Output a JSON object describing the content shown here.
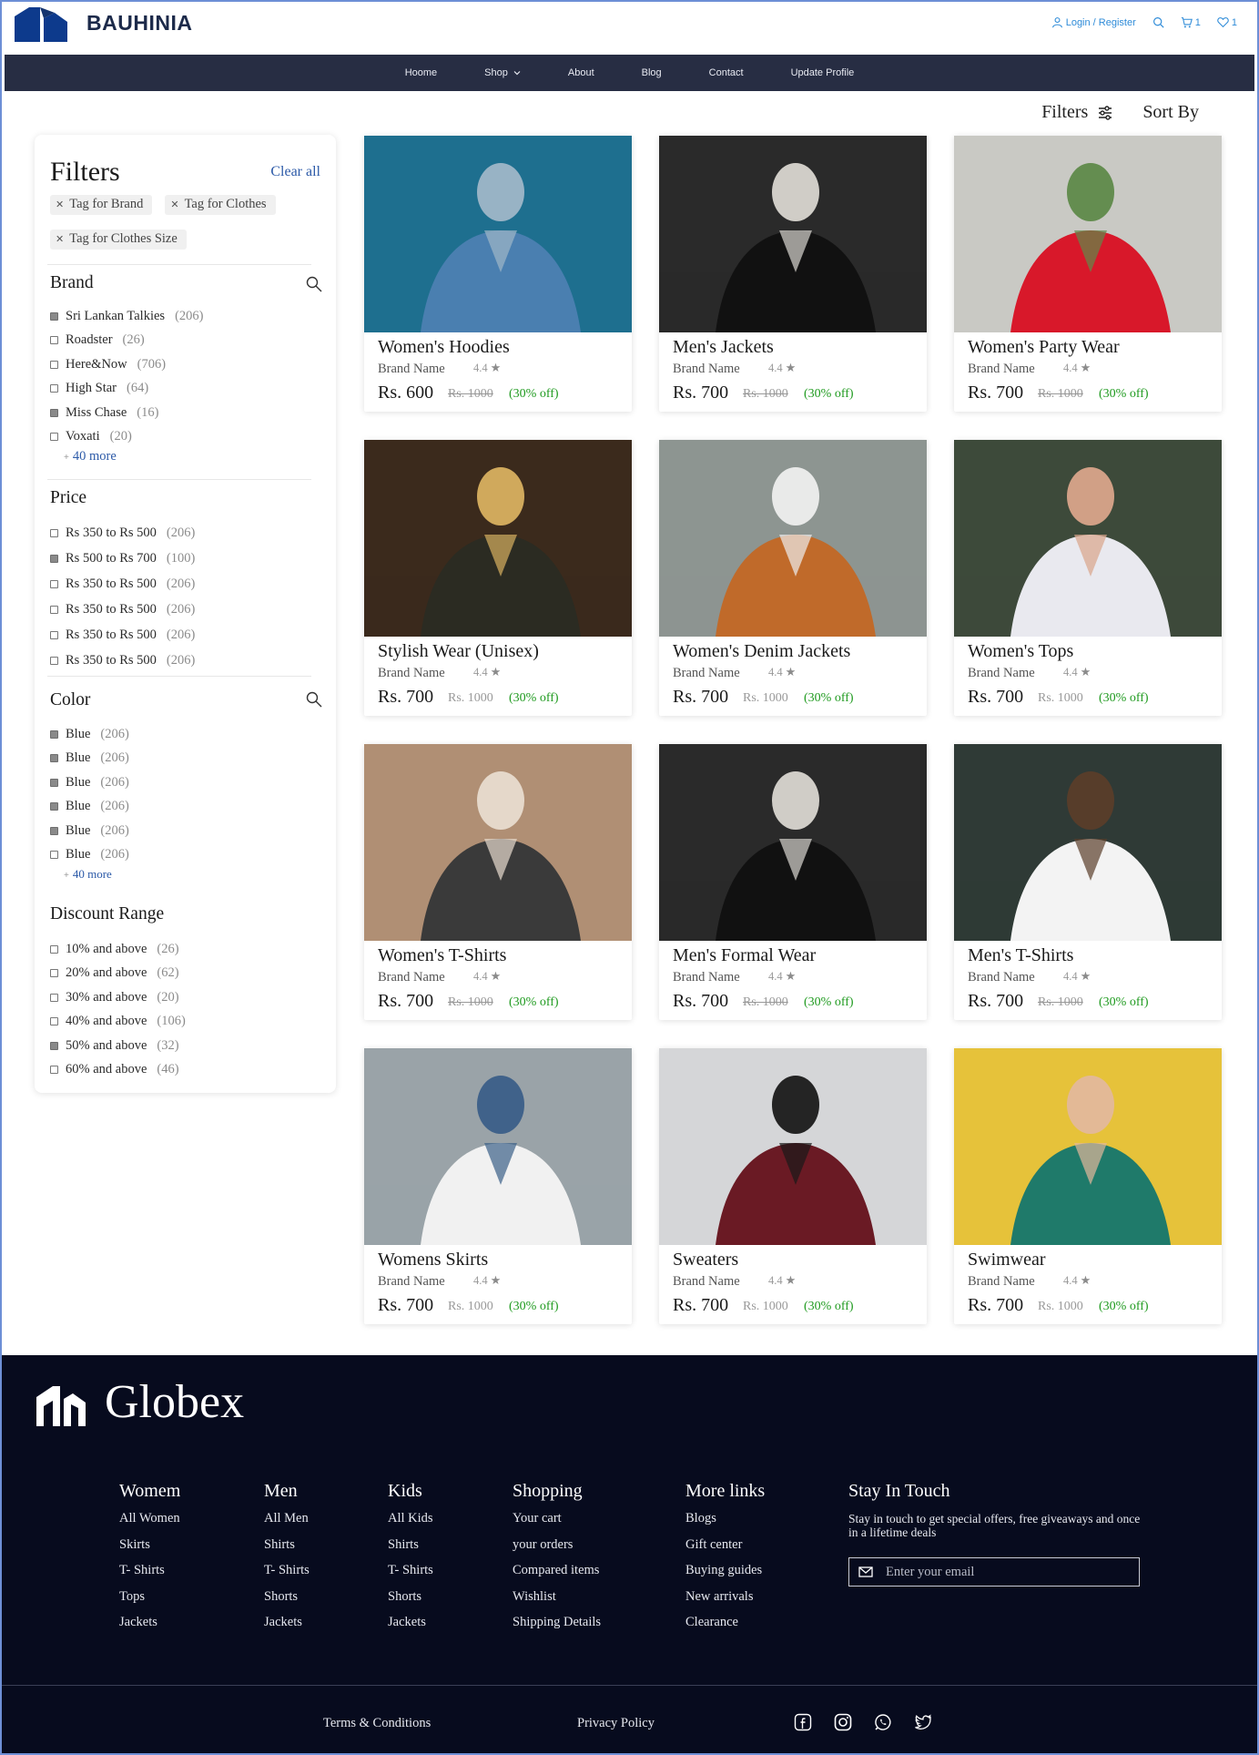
{
  "header": {
    "brand": "BAUHINIA",
    "login_label": "Login / Register",
    "cart_count": "1",
    "wishlist_count": "1"
  },
  "nav": {
    "items": [
      {
        "label": "Hoome"
      },
      {
        "label": "Shop"
      },
      {
        "label": "About"
      },
      {
        "label": "Blog"
      },
      {
        "label": "Contact"
      },
      {
        "label": "Update Profile"
      }
    ]
  },
  "toolbar": {
    "filters_label": "Filters",
    "sort_label": "Sort By"
  },
  "sidebar": {
    "title": "Filters",
    "clear_all": "Clear all",
    "tags": [
      "Tag for Brand",
      "Tag for Clothes",
      "Tag for Clothes Size"
    ],
    "brand": {
      "title": "Brand",
      "options": [
        {
          "label": "Sri Lankan Talkies",
          "count": "(206)",
          "checked": true
        },
        {
          "label": "Roadster",
          "count": "(26)",
          "checked": false
        },
        {
          "label": "Here&Now",
          "count": "(706)",
          "checked": false
        },
        {
          "label": "High Star",
          "count": "(64)",
          "checked": false
        },
        {
          "label": "Miss Chase",
          "count": "(16)",
          "checked": true
        },
        {
          "label": "Voxati",
          "count": "(20)",
          "checked": false
        }
      ],
      "more": "40 more"
    },
    "price": {
      "title": "Price",
      "options": [
        {
          "label": "Rs 350 to Rs 500",
          "count": "(206)",
          "checked": false
        },
        {
          "label": "Rs 500 to Rs 700",
          "count": "(100)",
          "checked": true
        },
        {
          "label": "Rs 350 to Rs 500",
          "count": "(206)",
          "checked": false
        },
        {
          "label": "Rs 350 to Rs 500",
          "count": "(206)",
          "checked": false
        },
        {
          "label": "Rs 350 to Rs 500",
          "count": "(206)",
          "checked": false
        },
        {
          "label": "Rs 350 to Rs 500",
          "count": "(206)",
          "checked": false
        }
      ]
    },
    "color": {
      "title": "Color",
      "options": [
        {
          "label": "Blue",
          "count": "(206)",
          "checked": true
        },
        {
          "label": "Blue",
          "count": "(206)",
          "checked": true
        },
        {
          "label": "Blue",
          "count": "(206)",
          "checked": true
        },
        {
          "label": "Blue",
          "count": "(206)",
          "checked": true
        },
        {
          "label": "Blue",
          "count": "(206)",
          "checked": true
        },
        {
          "label": "Blue",
          "count": "(206)",
          "checked": false
        }
      ],
      "more": "40 more"
    },
    "discount": {
      "title": "Discount Range",
      "options": [
        {
          "label": "10% and above",
          "count": "(26)",
          "checked": false
        },
        {
          "label": "20% and above",
          "count": "(62)",
          "checked": false
        },
        {
          "label": "30% and above",
          "count": "(20)",
          "checked": false
        },
        {
          "label": "40% and above",
          "count": "(106)",
          "checked": false
        },
        {
          "label": "50% and above",
          "count": "(32)",
          "checked": true
        },
        {
          "label": "60% and above",
          "count": "(46)",
          "checked": false
        }
      ]
    }
  },
  "products": [
    {
      "name": "Women's Hoodies",
      "brand": "Brand Name",
      "rating": "4.4",
      "price": "Rs. 600",
      "original": "Rs. 1000",
      "discount": "(30% off)",
      "strike": true,
      "colors": [
        "#1e6f8f",
        "#4a7fb0",
        "#9fb6c8"
      ]
    },
    {
      "name": "Men's Jackets",
      "brand": "Brand Name",
      "rating": "4.4",
      "price": "Rs. 700",
      "original": "Rs. 1000",
      "discount": "(30% off)",
      "strike": true,
      "colors": [
        "#2a2a2a",
        "#111111",
        "#d9d6d0"
      ]
    },
    {
      "name": "Women's Party Wear",
      "brand": "Brand Name",
      "rating": "4.4",
      "price": "Rs. 700",
      "original": "Rs. 1000",
      "discount": "(30% off)",
      "strike": true,
      "colors": [
        "#c9c9c4",
        "#d8182a",
        "#5f8a4a"
      ]
    },
    {
      "name": "Stylish Wear (Unisex)",
      "brand": "Brand Name",
      "rating": "4.4",
      "price": "Rs. 700",
      "original": "Rs. 1000",
      "discount": "(30% off)",
      "strike": false,
      "colors": [
        "#3b2a1c",
        "#2b2b22",
        "#d8b060"
      ]
    },
    {
      "name": "Women's Denim Jackets",
      "brand": "Brand Name",
      "rating": "4.4",
      "price": "Rs. 700",
      "original": "Rs. 1000",
      "discount": "(30% off)",
      "strike": false,
      "colors": [
        "#8d9591",
        "#c06a2a",
        "#eeeeee"
      ]
    },
    {
      "name": "Women's Tops",
      "brand": "Brand Name",
      "rating": "4.4",
      "price": "Rs. 700",
      "original": "Rs. 1000",
      "discount": "(30% off)",
      "strike": false,
      "colors": [
        "#3d4a3a",
        "#e9e9ef",
        "#d9a48a"
      ]
    },
    {
      "name": "Women's T-Shirts",
      "brand": "Brand Name",
      "rating": "4.4",
      "price": "Rs. 700",
      "original": "Rs. 1000",
      "discount": "(30% off)",
      "strike": true,
      "colors": [
        "#b08f74",
        "#3a3a3a",
        "#e8dccf"
      ]
    },
    {
      "name": "Men's Formal Wear",
      "brand": "Brand Name",
      "rating": "4.4",
      "price": "Rs. 700",
      "original": "Rs. 1000",
      "discount": "(30% off)",
      "strike": true,
      "colors": [
        "#2a2a2a",
        "#111111",
        "#d9d6d0"
      ]
    },
    {
      "name": "Men's T-Shirts",
      "brand": "Brand Name",
      "rating": "4.4",
      "price": "Rs. 700",
      "original": "Rs. 1000",
      "discount": "(30% off)",
      "strike": true,
      "colors": [
        "#2f3a36",
        "#f3f3f3",
        "#5a3d2a"
      ]
    },
    {
      "name": "Womens Skirts",
      "brand": "Brand Name",
      "rating": "4.4",
      "price": "Rs. 700",
      "original": "Rs. 1000",
      "discount": "(30% off)",
      "strike": false,
      "colors": [
        "#9aa3a8",
        "#f1f1f1",
        "#3b5f88"
      ]
    },
    {
      "name": "Sweaters",
      "brand": "Brand Name",
      "rating": "4.4",
      "price": "Rs. 700",
      "original": "Rs. 1000",
      "discount": "(30% off)",
      "strike": false,
      "colors": [
        "#d5d6d8",
        "#6a1a24",
        "#1a1a1a"
      ]
    },
    {
      "name": "Swimwear",
      "brand": "Brand Name",
      "rating": "4.4",
      "price": "Rs. 700",
      "original": "Rs. 1000",
      "discount": "(30% off)",
      "strike": false,
      "colors": [
        "#e6c23a",
        "#1f7a6a",
        "#e3b89b"
      ]
    }
  ],
  "footer": {
    "brand": "Globex",
    "columns": [
      {
        "title": "Womem",
        "links": [
          "All Women",
          "Skirts",
          "T- Shirts",
          "Tops",
          "Jackets"
        ]
      },
      {
        "title": "Men",
        "links": [
          "All Men",
          "Shirts",
          "T- Shirts",
          "Shorts",
          "Jackets"
        ]
      },
      {
        "title": "Kids",
        "links": [
          "All Kids",
          "Shirts",
          "T- Shirts",
          "Shorts",
          "Jackets"
        ]
      },
      {
        "title": "Shopping",
        "links": [
          "Your cart",
          "your orders",
          "Compared items",
          "Wishlist",
          "Shipping Details"
        ]
      },
      {
        "title": "More links",
        "links": [
          "Blogs",
          "Gift center",
          "Buying guides",
          "New arrivals",
          "Clearance"
        ]
      }
    ],
    "stay": {
      "title": "Stay In Touch",
      "text": "Stay in touch to get special offers, free giveaways and once in a lifetime deals",
      "email_placeholder": "Enter your email"
    },
    "terms": "Terms & Conditions",
    "privacy": "Privacy Policy"
  },
  "colors": {
    "nav_bg": "#272d43",
    "footer_bg": "#070b1e",
    "link_blue": "#2c5aa8",
    "discount_green": "#1e9a1e",
    "logo_blue": "#0d3a8c"
  },
  "icons": [
    "user-icon",
    "search-icon",
    "cart-icon",
    "heart-icon",
    "chevron-down-icon",
    "sliders-icon",
    "close-icon",
    "star-icon",
    "mail-icon",
    "facebook-icon",
    "instagram-icon",
    "whatsapp-icon",
    "twitter-icon"
  ]
}
